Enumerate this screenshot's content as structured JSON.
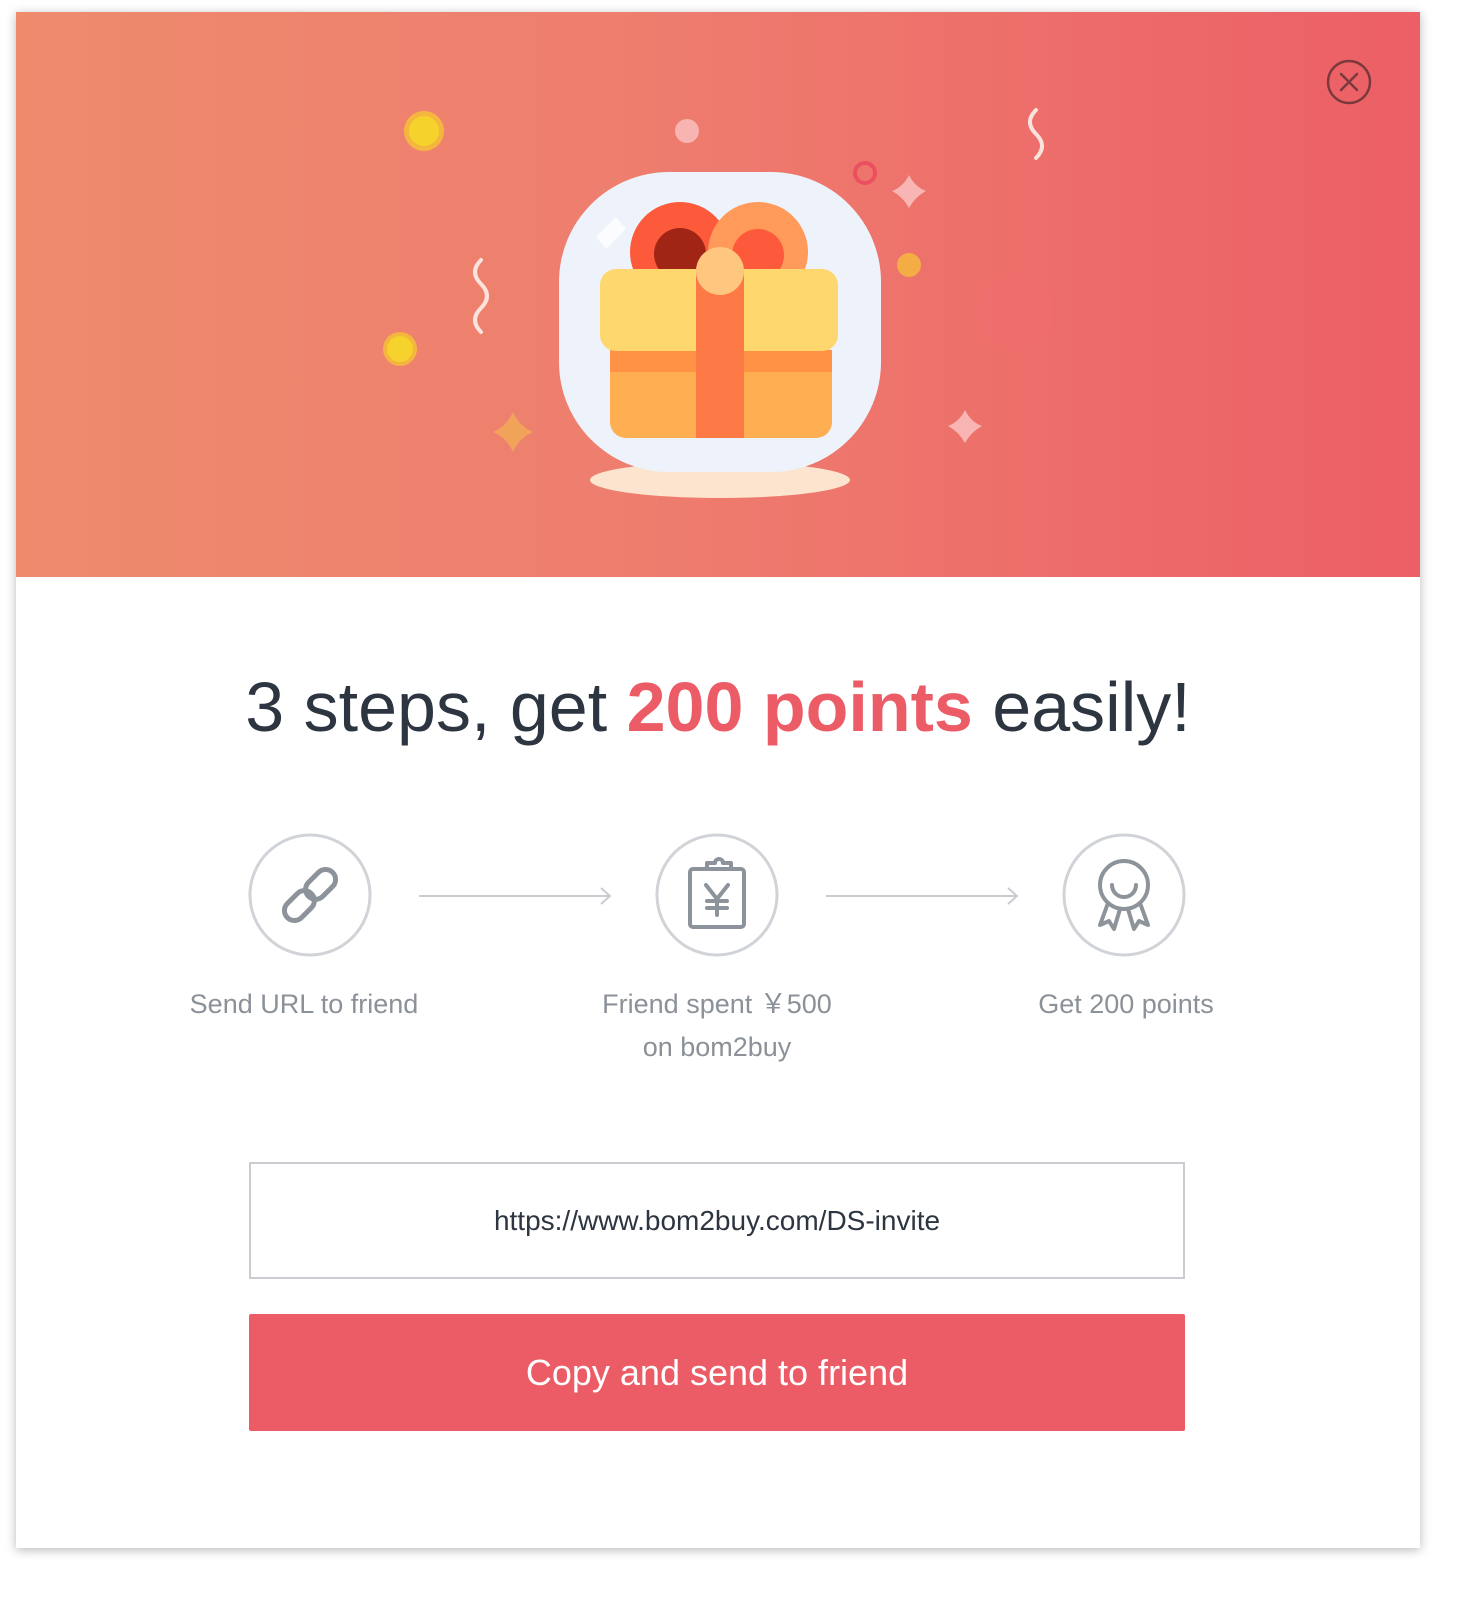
{
  "theme": {
    "accent": "#ec5c67",
    "banner_gradient": [
      "#ee8b6d",
      "#ec5f66"
    ],
    "text_dark": "#2d3540",
    "text_muted": "#8b9198"
  },
  "dialog": {
    "close_icon": "close-circle-icon",
    "banner_illustration": "gift-box-icon",
    "headline": {
      "prefix": "3 steps, get ",
      "highlight": "200 points",
      "suffix": " easily!"
    },
    "steps": [
      {
        "icon": "link-icon",
        "label": "Send URL to friend"
      },
      {
        "icon": "clipboard-yen-icon",
        "label_line1": "Friend spent ￥500",
        "label_line2": "on bom2buy"
      },
      {
        "icon": "award-medal-icon",
        "label": "Get 200 points"
      }
    ],
    "invite_url": "https://www.bom2buy.com/DS-invite",
    "copy_button_label": "Copy and send to friend"
  }
}
